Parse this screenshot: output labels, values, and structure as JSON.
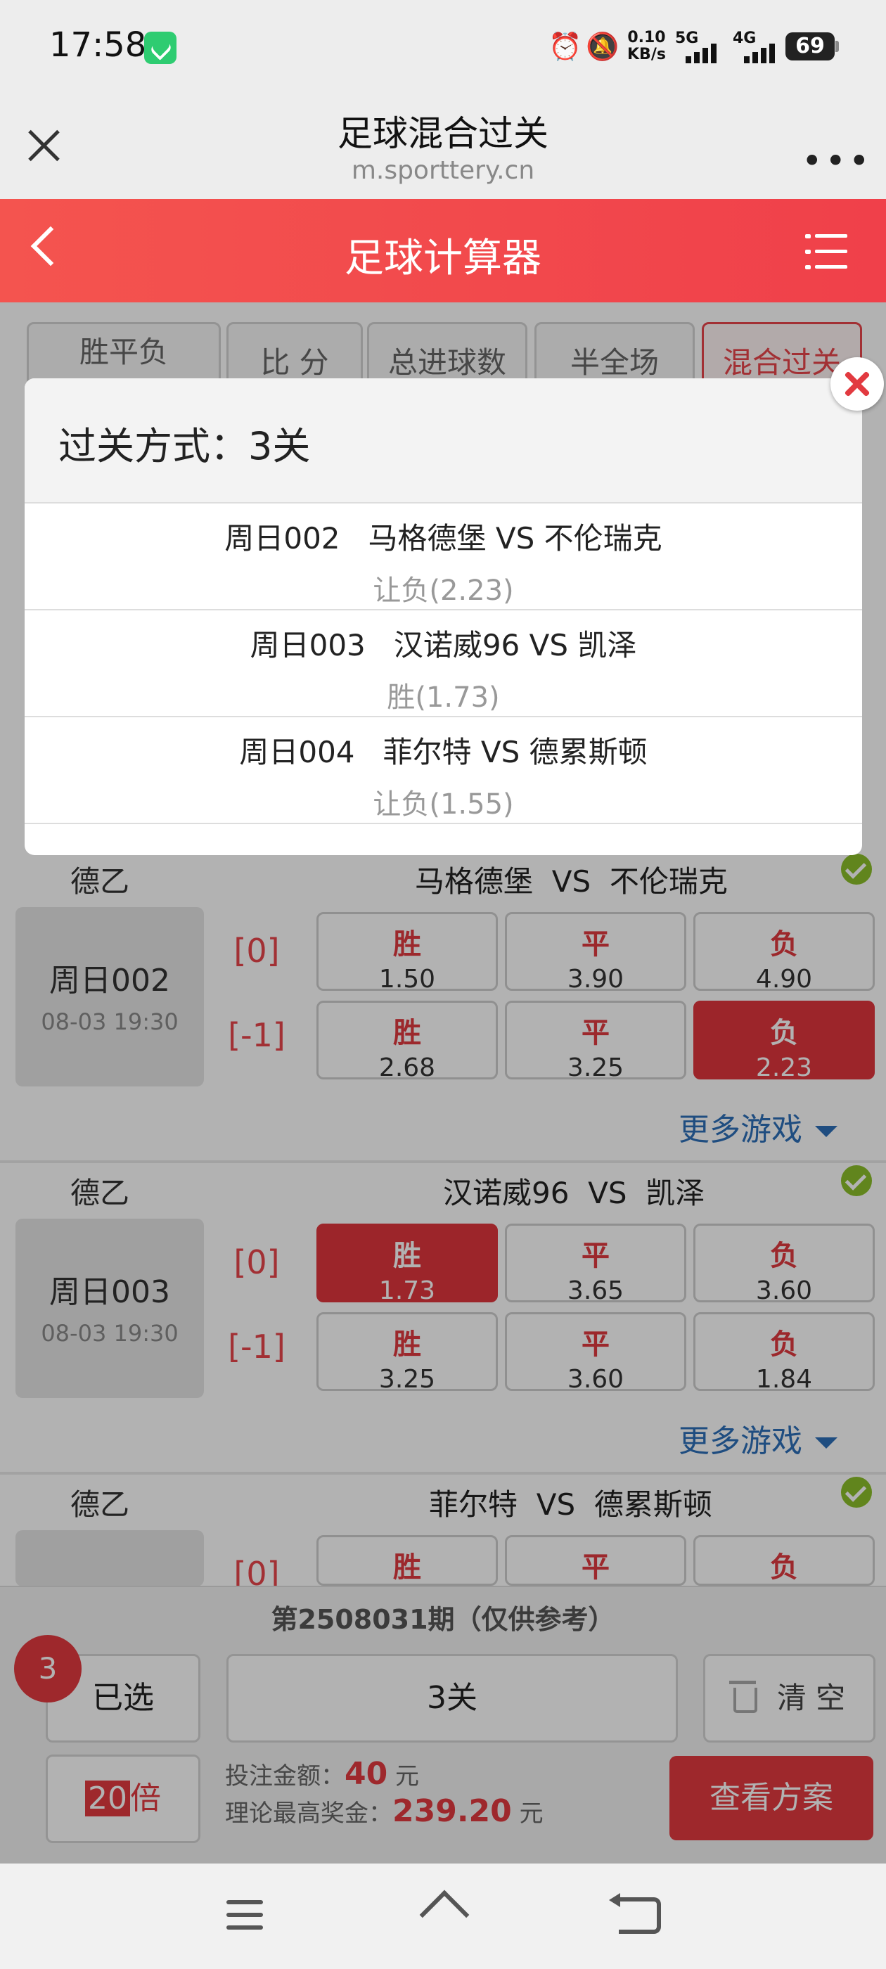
{
  "status": {
    "time": "17:58",
    "net_speed_value": "0.10",
    "net_speed_unit": "KB/s",
    "sig1": "5G",
    "sig2": "4G",
    "battery": "69"
  },
  "browser": {
    "title": "足球混合过关",
    "url": "m.sporttery.cn"
  },
  "app": {
    "title": "足球计算器"
  },
  "tabs": [
    {
      "label": "胜平负"
    },
    {
      "label": "比 分"
    },
    {
      "label": "总进球数"
    },
    {
      "label": "半全场"
    },
    {
      "label": "混合过关"
    }
  ],
  "matches": [
    {
      "league": "德乙",
      "home": "马格德堡",
      "vs": "VS",
      "away": "不伦瑞克",
      "no": "周日002",
      "time": "08-03 19:30",
      "rows": [
        {
          "handicap": "[0]",
          "odds": [
            {
              "label": "胜",
              "value": "1.50"
            },
            {
              "label": "平",
              "value": "3.90"
            },
            {
              "label": "负",
              "value": "4.90"
            }
          ]
        },
        {
          "handicap": "[-1]",
          "odds": [
            {
              "label": "胜",
              "value": "2.68"
            },
            {
              "label": "平",
              "value": "3.25"
            },
            {
              "label": "负",
              "value": "2.23",
              "selected": true
            }
          ]
        }
      ],
      "more": "更多游戏"
    },
    {
      "league": "德乙",
      "home": "汉诺威96",
      "vs": "VS",
      "away": "凯泽",
      "no": "周日003",
      "time": "08-03 19:30",
      "rows": [
        {
          "handicap": "[0]",
          "odds": [
            {
              "label": "胜",
              "value": "1.73",
              "selected": true
            },
            {
              "label": "平",
              "value": "3.65"
            },
            {
              "label": "负",
              "value": "3.60"
            }
          ]
        },
        {
          "handicap": "[-1]",
          "odds": [
            {
              "label": "胜",
              "value": "3.25"
            },
            {
              "label": "平",
              "value": "3.60"
            },
            {
              "label": "负",
              "value": "1.84"
            }
          ]
        }
      ],
      "more": "更多游戏"
    },
    {
      "league": "德乙",
      "home": "菲尔特",
      "vs": "VS",
      "away": "德累斯顿",
      "rows": [
        {
          "handicap": "[0]",
          "odds": [
            {
              "label": "胜"
            },
            {
              "label": "平"
            },
            {
              "label": "负"
            }
          ]
        }
      ]
    }
  ],
  "bottom": {
    "period": "第2508031期（仅供参考）",
    "selected_count": "3",
    "selected_label": "已选",
    "pass_type": "3关",
    "clear_label": "清 空",
    "multiplier": "20",
    "multiplier_unit": "倍",
    "bet_label": "投注金额：",
    "bet_amount": "40",
    "bet_unit": "元",
    "max_label": "理论最高奖金：",
    "max_amount": "239.20",
    "max_unit": "元",
    "view_label": "查看方案"
  },
  "modal": {
    "title": "过关方式：3关",
    "rows": [
      {
        "match": "周日002   马格德堡 VS 不伦瑞克",
        "pick": "让负(2.23)"
      },
      {
        "match": "周日003   汉诺威96 VS 凯泽",
        "pick": "胜(1.73)"
      },
      {
        "match": "周日004   菲尔特 VS 德累斯顿",
        "pick": "让负(1.55)"
      }
    ]
  },
  "colors": {
    "brand_red": "#e23a40",
    "link_blue": "#2d6fb8",
    "check_green": "#8bbf2a"
  }
}
